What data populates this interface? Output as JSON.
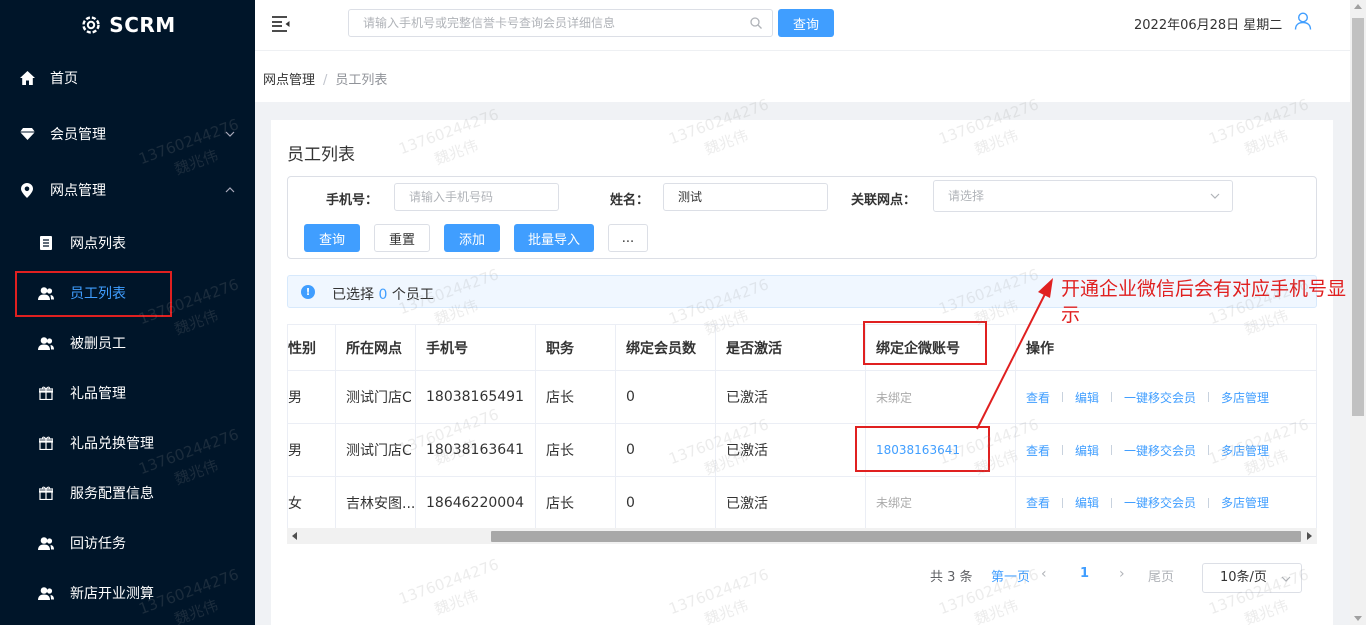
{
  "app": {
    "logo_text": "SCRM"
  },
  "sidebar": {
    "items": [
      {
        "label": "首页",
        "icon": "home-icon"
      },
      {
        "label": "会员管理",
        "icon": "diamond-icon"
      },
      {
        "label": "网点管理",
        "icon": "location-icon"
      }
    ],
    "subitems": [
      {
        "label": "网点列表",
        "icon": "document-icon"
      },
      {
        "label": "员工列表",
        "icon": "users-icon",
        "active": true
      },
      {
        "label": "被删员工",
        "icon": "users-icon"
      },
      {
        "label": "礼品管理",
        "icon": "gift-icon"
      },
      {
        "label": "礼品兑换管理",
        "icon": "gift-icon"
      },
      {
        "label": "服务配置信息",
        "icon": "gift-icon"
      },
      {
        "label": "回访任务",
        "icon": "users-icon"
      },
      {
        "label": "新店开业测算",
        "icon": "users-icon"
      }
    ]
  },
  "header": {
    "search_placeholder": "请输入手机号或完整信誉卡号查询会员详细信息",
    "search_button": "查询",
    "date": "2022年06月28日 星期二"
  },
  "breadcrumb": {
    "parent": "网点管理",
    "separator": "/",
    "current": "员工列表"
  },
  "page": {
    "title": "员工列表",
    "filters": {
      "phone_label": "手机号：",
      "phone_placeholder": "请输入手机号码",
      "name_label": "姓名：",
      "name_value": "测试",
      "outlet_label": "关联网点：",
      "outlet_placeholder": "请选择"
    },
    "buttons": {
      "query": "查询",
      "reset": "重置",
      "add": "添加",
      "batch_import": "批量导入",
      "more": "..."
    },
    "selection": {
      "prefix": "已选择",
      "count": "0",
      "suffix": "个员工"
    }
  },
  "table": {
    "headers": [
      "性别",
      "所在网点",
      "手机号",
      "职务",
      "绑定会员数",
      "是否激活",
      "绑定企微账号",
      "操作"
    ],
    "rows": [
      {
        "gender": "男",
        "outlet": "测试门店C",
        "phone": "18038165491",
        "role": "店长",
        "members": "0",
        "active": "已激活",
        "wecom": "未绑定",
        "bound": false
      },
      {
        "gender": "男",
        "outlet": "测试门店C",
        "phone": "18038163641",
        "role": "店长",
        "members": "0",
        "active": "已激活",
        "wecom": "18038163641",
        "bound": true
      },
      {
        "gender": "女",
        "outlet": "吉林安图...",
        "phone": "18646220004",
        "role": "店长",
        "members": "0",
        "active": "已激活",
        "wecom": "未绑定",
        "bound": false
      }
    ],
    "actions": [
      "查看",
      "编辑",
      "一键移交会员",
      "多店管理"
    ]
  },
  "pagination": {
    "total": "共 3 条",
    "first": "第一页",
    "current": "1",
    "last": "尾页",
    "page_size": "10条/页"
  },
  "annotation": {
    "text": "开通企业微信后会有对应手机号显示",
    "color": "#e02020"
  },
  "watermark": {
    "line1": "13760244276",
    "line2": "魏兆伟"
  },
  "colors": {
    "sidebar_bg": "#001529",
    "primary": "#409eff",
    "annotation_red": "#e02020"
  }
}
